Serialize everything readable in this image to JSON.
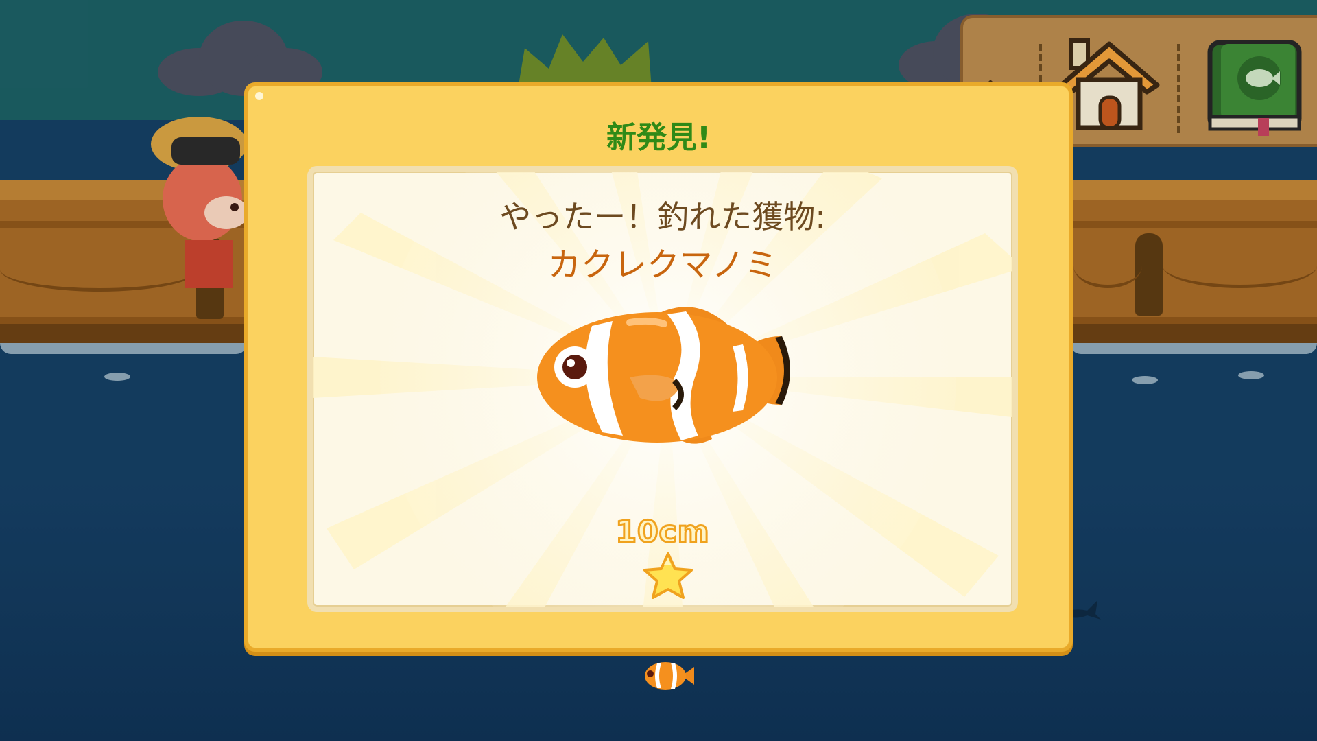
{
  "screen": "catch-result",
  "colors": {
    "dialog_bg": "#fbd25f",
    "dialog_border": "#e9aa2a",
    "title_green": "#2f8a17",
    "fish_name_orange": "#c8650e",
    "message_brown": "#6d4a20",
    "sea": "#153f63"
  },
  "toolbar": {
    "icons": [
      "pen-icon",
      "home-icon",
      "fish-book-icon"
    ]
  },
  "dialog": {
    "title": "新発見!",
    "message": "やったー！釣れた獲物:",
    "fish_name": "カクレクマノミ",
    "fish_icon": "clownfish-icon",
    "size": "10cm",
    "stars": 1,
    "star_icon": "star-icon"
  }
}
